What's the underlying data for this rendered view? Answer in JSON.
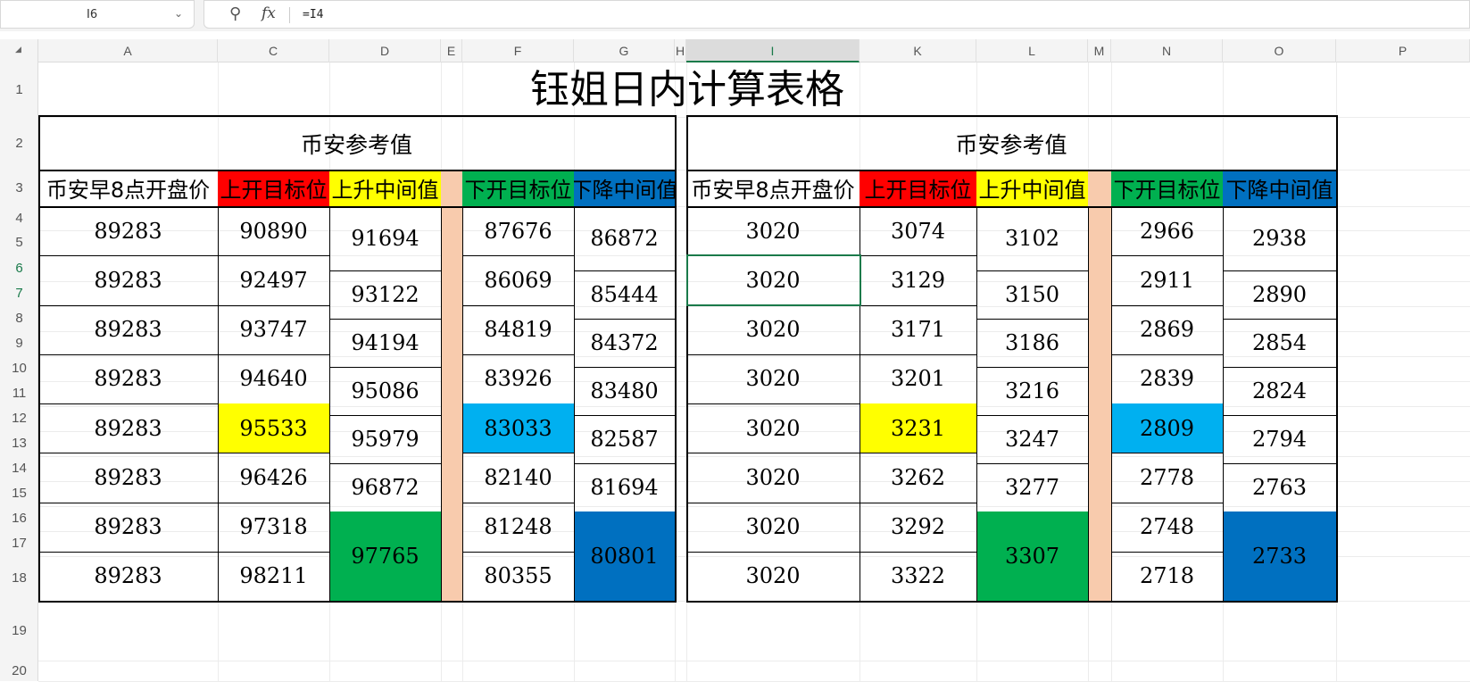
{
  "formula_bar": {
    "cell_ref": "I6",
    "formula": "=I4",
    "fx_label": "fx",
    "zoom_icon": "zoom-icon",
    "dropdown_icon": "chevron-down-icon"
  },
  "columns": [
    "A",
    "C",
    "D",
    "E",
    "F",
    "G",
    "H",
    "I",
    "K",
    "L",
    "M",
    "N",
    "O",
    "P"
  ],
  "rows": [
    "1",
    "2",
    "3",
    "4",
    "5",
    "6",
    "7",
    "8",
    "9",
    "10",
    "11",
    "12",
    "13",
    "14",
    "15",
    "16",
    "17",
    "18",
    "19",
    "20"
  ],
  "selected_column": "I",
  "selected_rows": [
    "6",
    "7"
  ],
  "sheet": {
    "title": "钰姐日内计算表格",
    "left": {
      "section": "币安参考值",
      "headers": [
        "币安早8点开盘价",
        "上开目标位",
        "上升中间值",
        "下开目标位",
        "下降中间值"
      ],
      "open": [
        "89283",
        "89283",
        "89283",
        "89283",
        "89283",
        "89283",
        "89283",
        "89283"
      ],
      "up_target": [
        "90890",
        "92497",
        "93747",
        "94640",
        "95533",
        "96426",
        "97318",
        "98211"
      ],
      "up_mid": [
        "91694",
        "93122",
        "94194",
        "95086",
        "95979",
        "96872",
        "97765"
      ],
      "down_target": [
        "87676",
        "86069",
        "84819",
        "83926",
        "83033",
        "82140",
        "81248",
        "80355"
      ],
      "down_mid": [
        "86872",
        "85444",
        "84372",
        "83480",
        "82587",
        "81694",
        "80801"
      ]
    },
    "right": {
      "section": "币安参考值",
      "headers": [
        "币安早8点开盘价",
        "上开目标位",
        "上升中间值",
        "下开目标位",
        "下降中间值"
      ],
      "open": [
        "3020",
        "3020",
        "3020",
        "3020",
        "3020",
        "3020",
        "3020",
        "3020"
      ],
      "up_target": [
        "3074",
        "3129",
        "3171",
        "3201",
        "3231",
        "3262",
        "3292",
        "3322"
      ],
      "up_mid": [
        "3102",
        "3150",
        "3186",
        "3216",
        "3247",
        "3277",
        "3307"
      ],
      "down_target": [
        "2966",
        "2911",
        "2869",
        "2839",
        "2809",
        "2778",
        "2748",
        "2718"
      ],
      "down_mid": [
        "2938",
        "2890",
        "2854",
        "2824",
        "2794",
        "2763",
        "2733"
      ]
    }
  },
  "colors": {
    "header_red": "#ff0000",
    "header_yellow": "#ffff00",
    "header_green": "#00b050",
    "header_blue": "#0070c0",
    "highlight_yellow": "#ffff00",
    "highlight_cyan": "#00b0f0",
    "highlight_green": "#00b050",
    "highlight_blue": "#0070c0",
    "separator_peach": "#f8cbad",
    "selection": "#1a7a4a"
  }
}
